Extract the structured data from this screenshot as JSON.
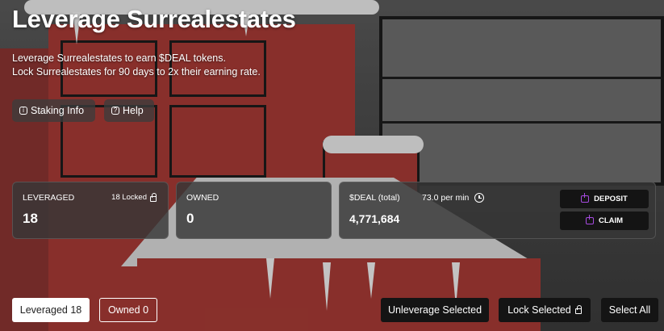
{
  "header": {
    "title": "Leverage Surrealestates",
    "description_line1": "Leverage Surrealestates to earn $DEAL tokens.",
    "description_line2": "Lock Surrealestates for 90 days to 2x their earning rate."
  },
  "actions": {
    "staking_info_label": "Staking Info",
    "help_label": "Help"
  },
  "stats": {
    "leveraged": {
      "label": "LEVERAGED",
      "value": "18",
      "locked_text": "18 Locked"
    },
    "owned": {
      "label": "OWNED",
      "value": "0"
    },
    "deal": {
      "label": "$DEAL (total)",
      "rate": "73.0 per min",
      "value": "4,771,684",
      "deposit_label": "DEPOSIT",
      "claim_label": "CLAIM"
    }
  },
  "bottom": {
    "tab_leveraged": "Leveraged 18",
    "tab_owned": "Owned 0",
    "unleverage_label": "Unleverage Selected",
    "lock_selected_label": "Lock Selected",
    "select_all_label": "Select All"
  },
  "colors": {
    "accent_purple": "#a64ae0",
    "card_bg": "#373737",
    "button_dark": "#141414"
  },
  "icons": [
    "info-icon",
    "help-icon",
    "lock-icon",
    "clock-icon",
    "deposit-icon",
    "claim-icon"
  ]
}
